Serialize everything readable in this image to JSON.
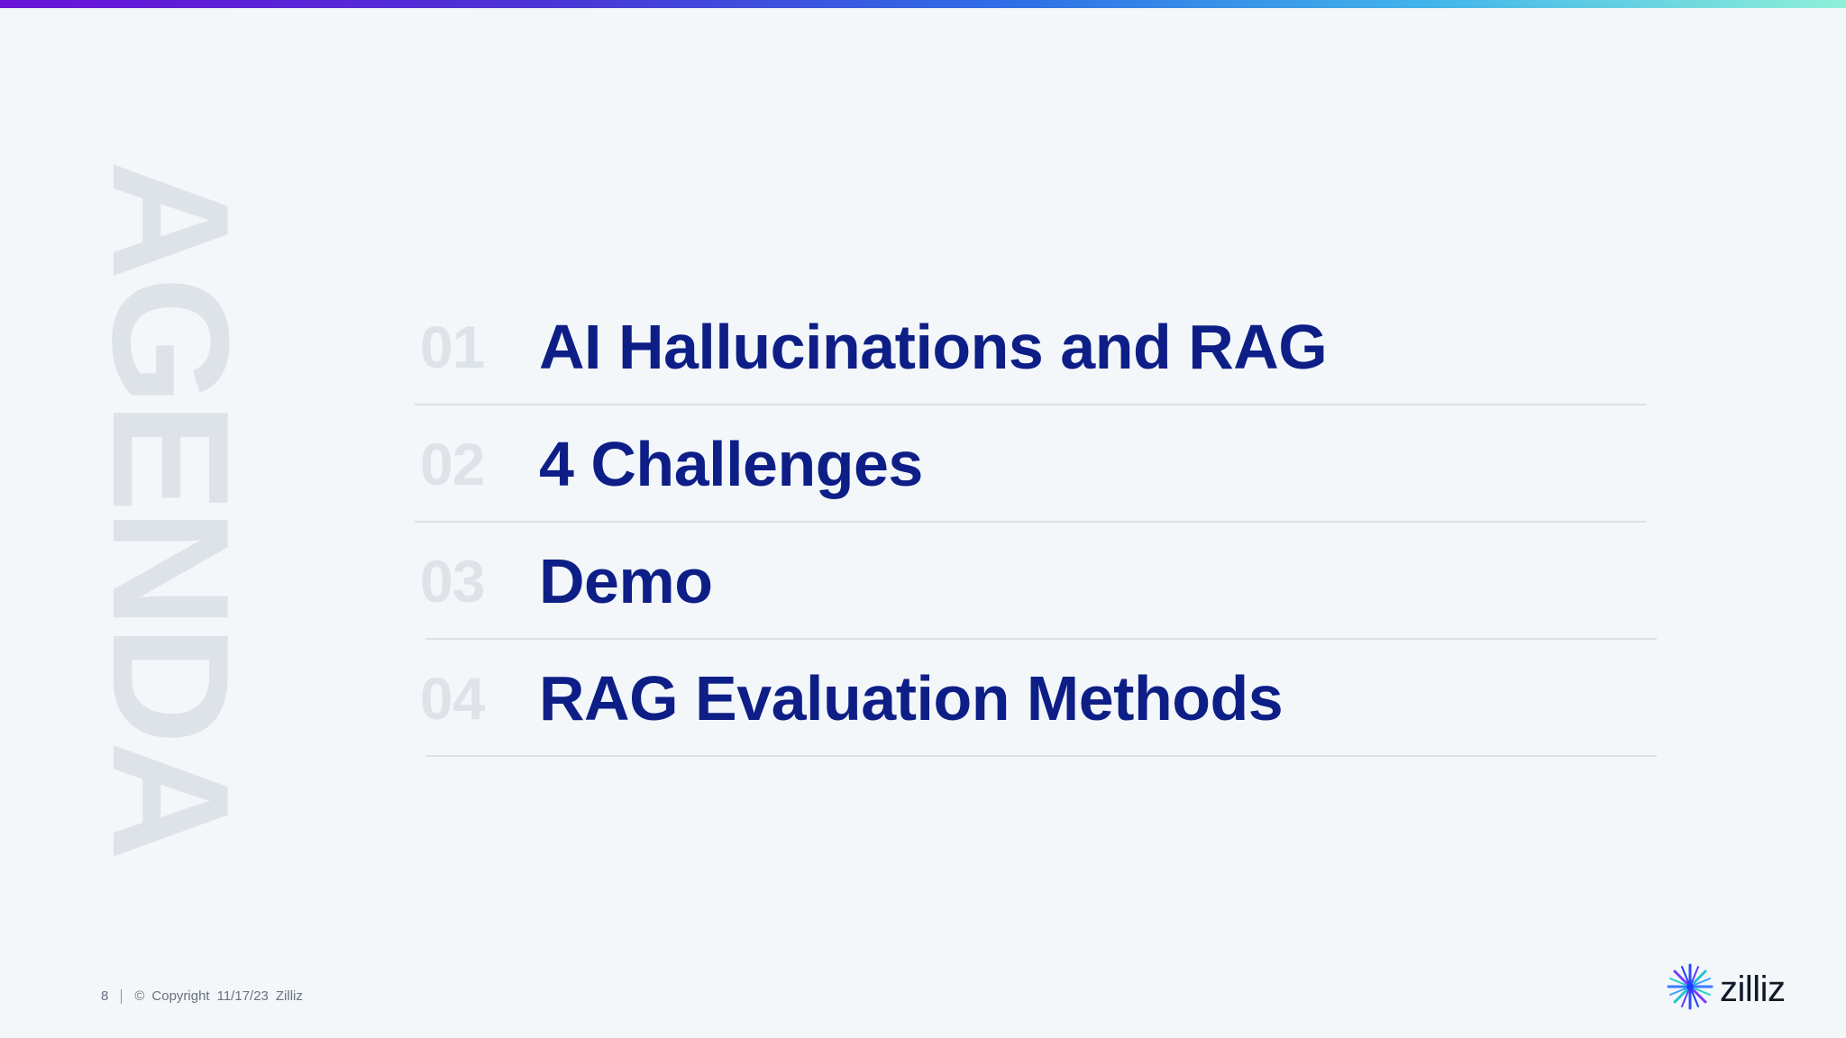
{
  "slide": {
    "watermark": "AGENDA",
    "items": [
      {
        "number": "01",
        "title": "AI Hallucinations and RAG"
      },
      {
        "number": "02",
        "title": "4 Challenges"
      },
      {
        "number": "03",
        "title": "Demo"
      },
      {
        "number": "04",
        "title": "RAG Evaluation Methods"
      }
    ]
  },
  "footer": {
    "page_number": "8",
    "copyright_symbol": "©",
    "copyright_label": "Copyright",
    "date": "11/17/23",
    "company": "Zilliz"
  },
  "logo": {
    "text": "zilliz",
    "icon": "starburst-icon",
    "colors": [
      "#1e3cff",
      "#3aa0ff",
      "#20d0c8",
      "#7a3cff"
    ]
  },
  "colors": {
    "background": "#f3f7fa",
    "title": "#0e1e87",
    "number": "#dde3e9",
    "watermark": "#dde3e9"
  }
}
